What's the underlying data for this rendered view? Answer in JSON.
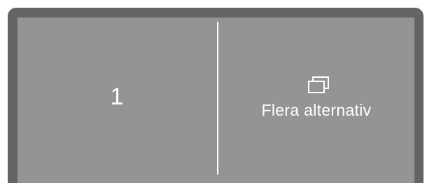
{
  "options": {
    "left": {
      "value": "1"
    },
    "right": {
      "icon": "multiple-windows-icon",
      "label": "Flera alternativ"
    }
  },
  "colors": {
    "frame": "#646467",
    "panel": "#949497",
    "text": "#ffffff",
    "divider": "#ffffff"
  }
}
